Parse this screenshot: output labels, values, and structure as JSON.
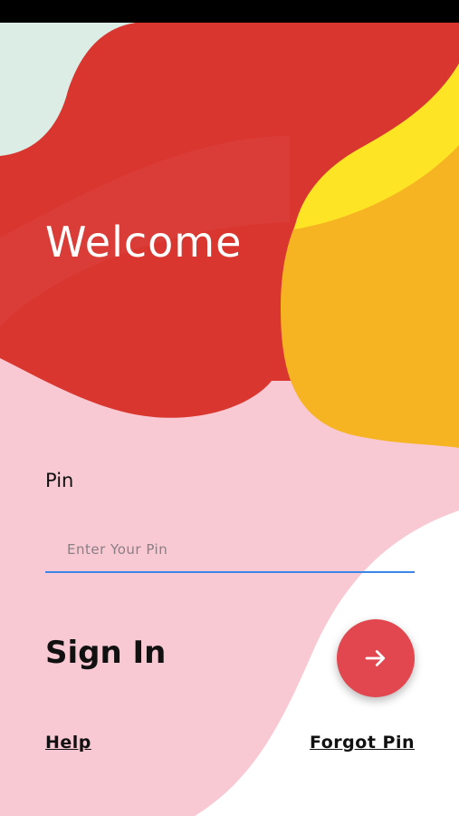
{
  "login": {
    "welcome_title": "Welcome",
    "pin_label": "Pin",
    "pin_placeholder": "Enter Your Pin",
    "pin_value": "",
    "sign_in_title": "Sign In",
    "submit_icon": "arrow-right-icon",
    "help_link": "Help",
    "forgot_pin_link": "Forgot Pin"
  },
  "colors": {
    "red_blob": "#d9362f",
    "yellow_blob": "#f7b422",
    "bright_yellow": "#fde525",
    "pink_background": "#f8c9d3",
    "mint_corner": "#dcede6",
    "input_underline": "#3b86e6",
    "fab_background": "#e2474f",
    "text_dark": "#111111",
    "text_light": "#ffffff"
  }
}
